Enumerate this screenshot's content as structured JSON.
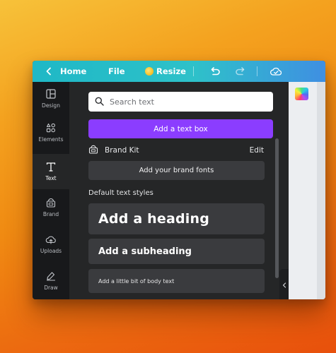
{
  "topbar": {
    "home_label": "Home",
    "file_label": "File",
    "resize_label": "Resize"
  },
  "rail": {
    "items": [
      {
        "label": "Design",
        "icon": "design-icon",
        "active": false
      },
      {
        "label": "Elements",
        "icon": "elements-icon",
        "active": false
      },
      {
        "label": "Text",
        "icon": "text-icon",
        "active": true
      },
      {
        "label": "Brand",
        "icon": "brand-icon",
        "active": false
      },
      {
        "label": "Uploads",
        "icon": "uploads-icon",
        "active": false
      },
      {
        "label": "Draw",
        "icon": "draw-icon",
        "active": false
      }
    ]
  },
  "panel": {
    "search_placeholder": "Search text",
    "add_text_box": "Add a text box",
    "brand_kit_label": "Brand Kit",
    "brand_kit_edit": "Edit",
    "add_brand_fonts": "Add your brand fonts",
    "default_styles_title": "Default text styles",
    "heading_label": "Add a heading",
    "subheading_label": "Add a subheading",
    "body_label": "Add a little bit of body text"
  },
  "colors": {
    "accent_purple": "#8b3dff",
    "topbar_start": "#1fb8c6",
    "topbar_end": "#3f8fe2",
    "panel_bg": "#252627",
    "rail_bg": "#18191b"
  }
}
